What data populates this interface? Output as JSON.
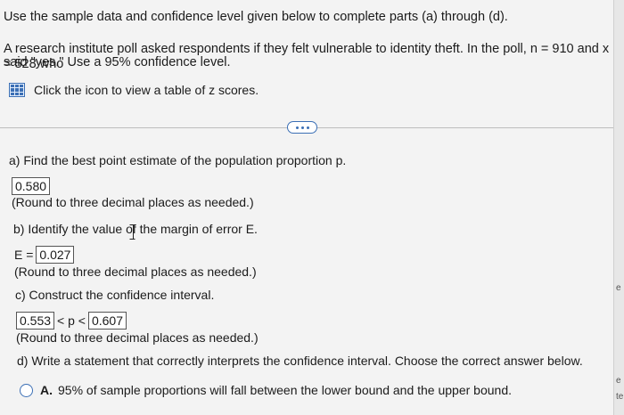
{
  "header": {
    "instructions": "Use the sample data and confidence level given below to complete parts (a) through (d).",
    "problem_line1": "A research institute poll asked respondents if they felt vulnerable to identity theft. In the poll, n = 910 and x = 528 who",
    "problem_line2": "said \"yes.\" Use a 95% confidence level.",
    "table_link": "Click the icon to view a table of z scores."
  },
  "parts": {
    "a": {
      "question": "a) Find the best point estimate of the population proportion p.",
      "answer": "0.580",
      "note": "(Round to three decimal places as needed.)"
    },
    "b": {
      "question": "b) Identify the value of the margin of error E.",
      "prefix": "E =",
      "answer": "0.027",
      "note": "(Round to three decimal places as needed.)"
    },
    "c": {
      "question": "c) Construct the confidence interval.",
      "lower": "0.553",
      "middle": "< p <",
      "upper": "0.607",
      "note": "(Round to three decimal places as needed.)"
    },
    "d": {
      "question": "d) Write a statement that correctly interprets the confidence interval. Choose the correct answer below.",
      "option_a_label": "A.",
      "option_a_text": "95% of sample proportions will fall between the lower bound and the upper bound."
    }
  },
  "edge_glyphs": [
    "e",
    "te",
    "t",
    "e"
  ],
  "colors": {
    "accent": "#3b6fb5",
    "background": "#f3f3f3"
  }
}
